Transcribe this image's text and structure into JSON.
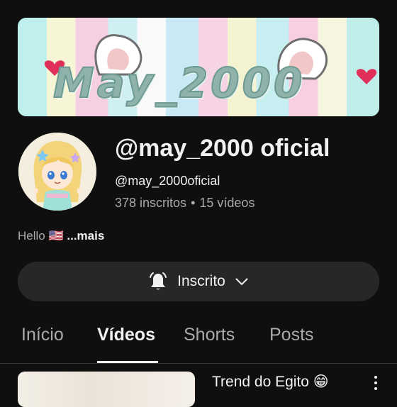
{
  "banner": {
    "text": "May_2000"
  },
  "channel": {
    "name": "@may_2000 oficial",
    "handle": "@may_2000oficial",
    "subscribers": "378 inscritos",
    "separator": "•",
    "videos": "15 vídeos"
  },
  "description": {
    "text": "Hello 🇺🇸",
    "more": "...mais"
  },
  "subscribe_button": {
    "label": "Inscrito"
  },
  "tabs": [
    {
      "label": "Início"
    },
    {
      "label": "Vídeos",
      "active": true
    },
    {
      "label": "Shorts"
    },
    {
      "label": "Posts"
    }
  ],
  "video": {
    "title": "Trend do Egito 😁"
  },
  "colors": {
    "background": "#0f0f0f",
    "button": "#272727",
    "secondary_text": "#aaaaaa"
  }
}
